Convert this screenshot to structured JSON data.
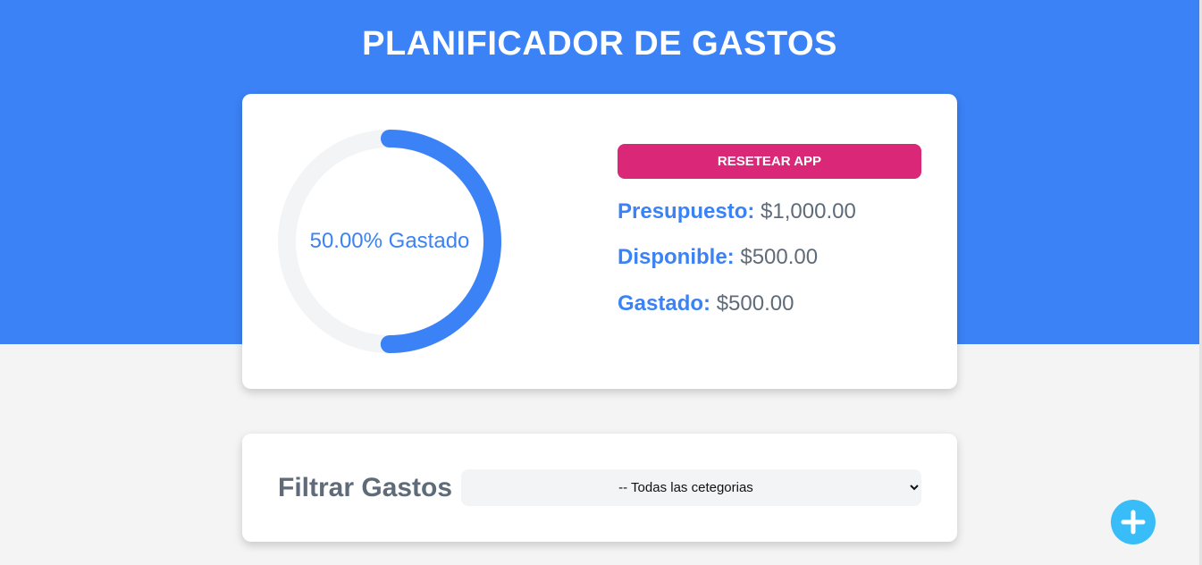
{
  "header": {
    "title": "PLANIFICADOR DE GASTOS"
  },
  "budget": {
    "progress_label": "50.00% Gastado",
    "progress_fraction": 0.5,
    "reset_label": "RESETEAR APP",
    "presupuesto_label": "Presupuesto:",
    "presupuesto_value": "$1,000.00",
    "disponible_label": "Disponible:",
    "disponible_value": "$500.00",
    "gastado_label": "Gastado:",
    "gastado_value": "$500.00"
  },
  "filter": {
    "label": "Filtrar Gastos",
    "selected": "-- Todas las cetegorias"
  },
  "fab": {
    "icon": "plus-icon"
  },
  "colors": {
    "primary": "#3b82f6",
    "reset": "#db2777",
    "fab": "#38bdf8",
    "track": "#f3f4f6"
  }
}
